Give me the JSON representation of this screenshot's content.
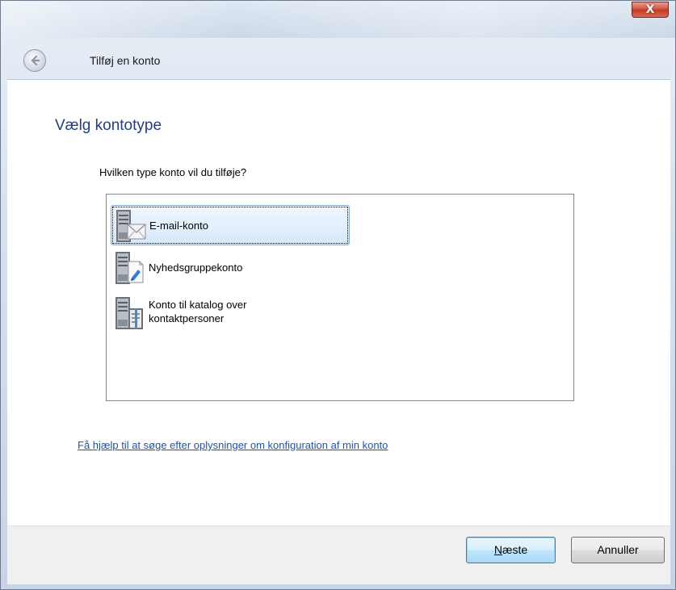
{
  "window": {
    "close_glyph": "X"
  },
  "header": {
    "title": "Tilføj en konto",
    "back_icon": "back-arrow-icon"
  },
  "main": {
    "heading": "Vælg kontotype",
    "question": "Hvilken type konto vil du tilføje?",
    "account_types": [
      {
        "label": "E-mail-konto",
        "icon": "email-account-icon",
        "selected": true
      },
      {
        "label": "Nyhedsgruppekonto",
        "icon": "newsgroup-account-icon",
        "selected": false
      },
      {
        "label_line1": "Konto til katalog over",
        "label_line2": "kontaktpersoner",
        "icon": "directory-account-icon",
        "selected": false
      }
    ],
    "help_link": "Få hjælp til at søge efter oplysninger om konfiguration af min konto"
  },
  "footer": {
    "next_mnemonic": "N",
    "next_rest": "æste",
    "cancel_label": "Annuller"
  },
  "colors": {
    "heading": "#1e3e8c",
    "link": "#1a54b4",
    "selection_border": "#84acdd",
    "close_button": "#c23a23"
  }
}
